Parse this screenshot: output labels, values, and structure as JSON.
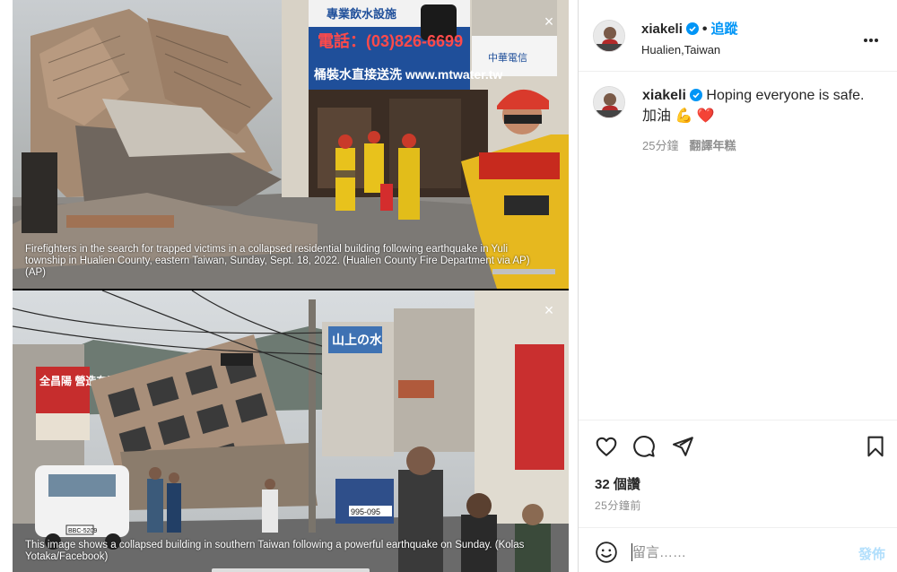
{
  "post": {
    "images": [
      {
        "caption": "Firefighters in the search for trapped victims in a collapsed residential building following earthquake in Yuli township in Hualien County, eastern Taiwan, Sunday, Sept. 18, 2022. (Hualien County Fire Department via AP) (AP)",
        "sign_phone": "電話：(03)826-6699",
        "sign_url": "桶裝水直接送洗 www.mtwater.tw",
        "sign_top": "專業飲水設施",
        "sign_side": "中華電信",
        "close_icon": "×"
      },
      {
        "caption": "This image shows a collapsed building in southern Taiwan following a powerful earthquake on Sunday. (Kolas Yotaka/Facebook)",
        "sign_shop": "山上の水",
        "sign_left": "全昌陽 營造有限公司",
        "plate": "BBC-5209",
        "truck_plate": "995-095",
        "close_icon": "×"
      }
    ]
  },
  "header": {
    "username": "xiakeli",
    "separator": "•",
    "follow_label": "追蹤",
    "location": "Hualien,Taiwan"
  },
  "comment": {
    "username": "xiakeli",
    "text": "Hoping everyone is safe.",
    "text_line2": "加油 💪 ❤️",
    "time": "25分鐘",
    "translate": "翻譯年糕"
  },
  "actions": {
    "likes": "32 個讚",
    "time": "25分鐘前"
  },
  "composer": {
    "placeholder": "留言……",
    "post_label": "發佈"
  },
  "colors": {
    "accent": "#0095f6",
    "post_disabled": "#b2dffc",
    "secondary_text": "#8e8e8e"
  },
  "icons": [
    "close-icon",
    "verified-icon",
    "more-icon",
    "heart-icon",
    "comment-icon",
    "share-icon",
    "bookmark-icon",
    "emoji-icon"
  ]
}
